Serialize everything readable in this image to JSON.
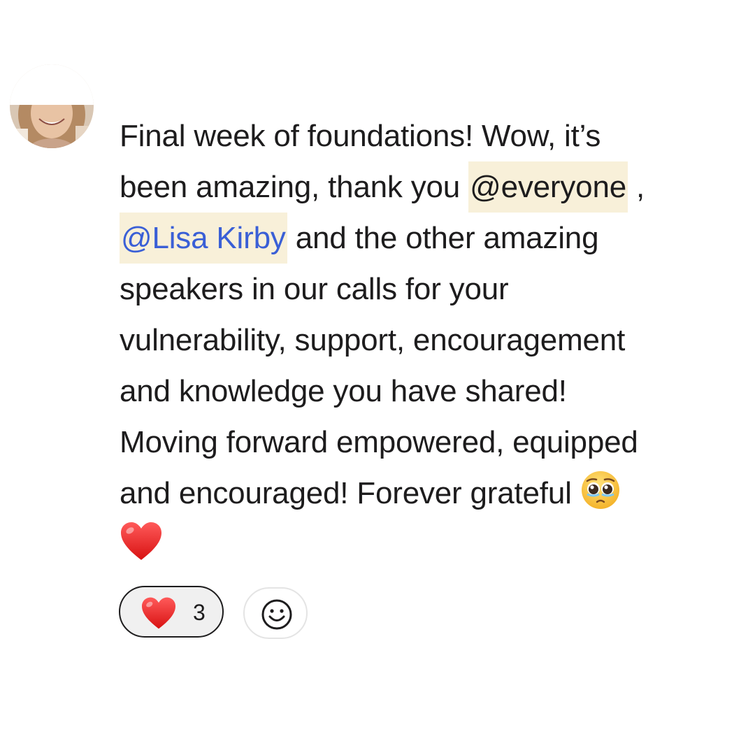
{
  "message": {
    "lines": [
      "Final week of foundations! Wow, it’s",
      "been amazing, thank you",
      ",",
      "and the other amazing",
      "speakers in our calls for your",
      "vulnerability, support, encouragement",
      "and knowledge you have shared!",
      "Moving forward empowered, equipped",
      "and encouraged! Forever grateful"
    ],
    "mentions": {
      "group": "@everyone",
      "user": "@Lisa Kirby"
    },
    "emojis": [
      "pleading-face",
      "red-heart"
    ]
  },
  "reactions": [
    {
      "emoji": "red-heart",
      "count": "3",
      "reacted": true
    }
  ],
  "add_reaction": {
    "icon": "smiley-icon"
  },
  "colors": {
    "mention_bg": "#f8f0d9",
    "mention_user": "#3a5fd6",
    "text": "#1d1c1d"
  }
}
